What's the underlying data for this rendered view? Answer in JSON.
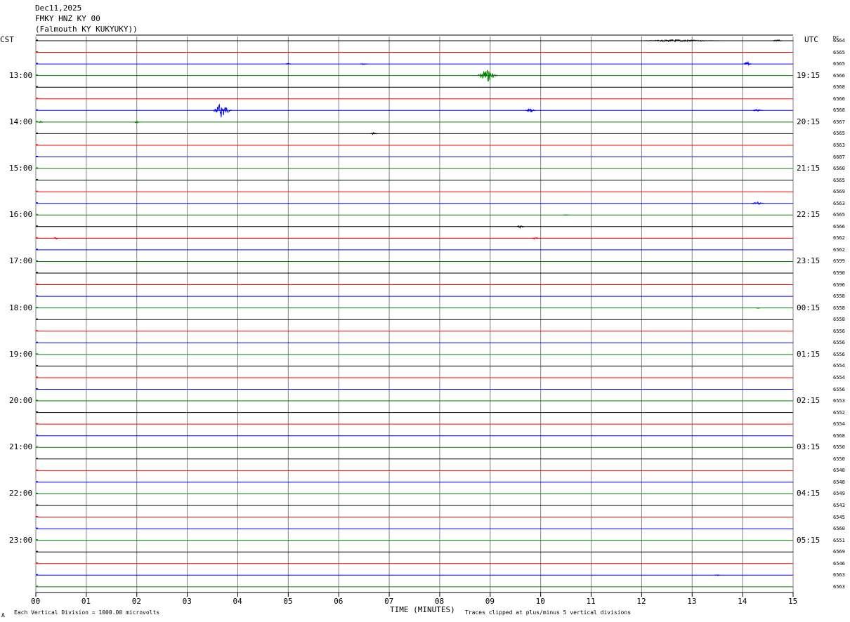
{
  "header": {
    "date": "Dec11,2025",
    "station": "FMKY HNZ KY 00",
    "location": "(Falmouth KY KUKYUKY))"
  },
  "labels": {
    "left_tz": "CST",
    "right_tz": "UTC",
    "dc": "DC"
  },
  "footer": {
    "scale": "Each Vertical Division = 1000.00 microvolts",
    "xlabel": "TIME (MINUTES)",
    "clip": "Traces clipped at plus/minus 5 vertical divisions",
    "mark": "A"
  },
  "colors": {
    "trace_cycle": [
      "#000000",
      "#ff0000",
      "#0000ff",
      "#008000"
    ],
    "grid": "#808080"
  },
  "chart_data": {
    "type": "line",
    "title": "",
    "xlabel": "TIME (MINUTES)",
    "ylabel": "",
    "xlim": [
      0,
      15
    ],
    "x_ticks": [
      "00",
      "01",
      "02",
      "03",
      "04",
      "05",
      "06",
      "07",
      "08",
      "09",
      "10",
      "11",
      "12",
      "13",
      "14",
      "15"
    ],
    "trace_count": 48,
    "trace_interval_minutes": 15,
    "hour_labels_left": [
      "13:00",
      "14:00",
      "15:00",
      "16:00",
      "17:00",
      "18:00",
      "19:00",
      "20:00",
      "21:00",
      "22:00",
      "23:00"
    ],
    "hour_labels_right": [
      "19:15",
      "20:15",
      "21:15",
      "22:15",
      "23:15",
      "00:15",
      "01:15",
      "02:15",
      "03:15",
      "04:15",
      "05:15"
    ],
    "dc_offsets": [
      "6564",
      "6565",
      "6565",
      "6566",
      "6568",
      "6566",
      "6568",
      "6567",
      "6565",
      "6563",
      "6607",
      "6560",
      "6565",
      "6569",
      "6563",
      "6565",
      "6566",
      "6562",
      "6562",
      "6599",
      "6590",
      "6596",
      "6558",
      "6558",
      "6558",
      "6556",
      "6556",
      "6556",
      "6554",
      "6554",
      "6556",
      "6553",
      "6552",
      "6554",
      "6568",
      "6550",
      "6550",
      "6548",
      "6548",
      "6549",
      "6543",
      "6545",
      "6560",
      "6551",
      "6569",
      "6546",
      "6563",
      "6563"
    ],
    "events": [
      {
        "trace": 3,
        "minute": 8.95,
        "amp": 9,
        "width": 0.4
      },
      {
        "trace": 6,
        "minute": 3.7,
        "amp": 11,
        "width": 0.35
      },
      {
        "trace": 6,
        "minute": 9.8,
        "amp": 3,
        "width": 0.2
      },
      {
        "trace": 6,
        "minute": 14.3,
        "amp": 1.5,
        "width": 0.2
      },
      {
        "trace": 2,
        "minute": 14.1,
        "amp": 3,
        "width": 0.15
      },
      {
        "trace": 2,
        "minute": 5.0,
        "amp": 1,
        "width": 0.1
      },
      {
        "trace": 2,
        "minute": 6.5,
        "amp": 1,
        "width": 0.15
      },
      {
        "trace": 7,
        "minute": 2.0,
        "amp": 1.5,
        "width": 0.1
      },
      {
        "trace": 7,
        "minute": 0.1,
        "amp": 1.5,
        "width": 0.1
      },
      {
        "trace": 8,
        "minute": 6.7,
        "amp": 1.5,
        "width": 0.15
      },
      {
        "trace": 14,
        "minute": 14.3,
        "amp": 2,
        "width": 0.25
      },
      {
        "trace": 15,
        "minute": 10.5,
        "amp": 0.8,
        "width": 0.1
      },
      {
        "trace": 16,
        "minute": 9.6,
        "amp": 2,
        "width": 0.15
      },
      {
        "trace": 17,
        "minute": 9.9,
        "amp": 2,
        "width": 0.12
      },
      {
        "trace": 17,
        "minute": 0.4,
        "amp": 1.5,
        "width": 0.1
      },
      {
        "trace": 0,
        "minute": 12.8,
        "amp": 1.5,
        "width": 1.5
      },
      {
        "trace": 0,
        "minute": 14.7,
        "amp": 1.5,
        "width": 0.2
      },
      {
        "trace": 23,
        "minute": 14.3,
        "amp": 0.8,
        "width": 0.1
      },
      {
        "trace": 46,
        "minute": 13.5,
        "amp": 0.8,
        "width": 0.1
      }
    ]
  }
}
